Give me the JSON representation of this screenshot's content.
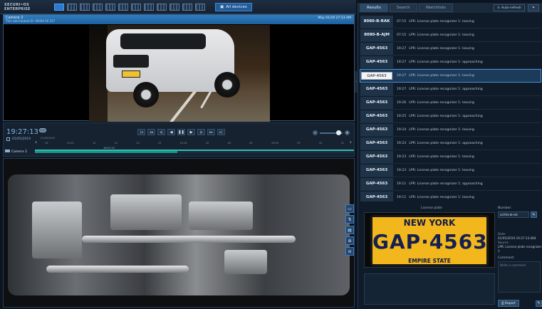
{
  "topbar": {
    "logo_line1": "SECURI•OS",
    "logo_line2": "ENTERPRISE",
    "all_devices": "All devices",
    "layout_icons": [
      "layout-1x1-icon",
      "layout-2x2-icon",
      "layout-3x3-icon",
      "layout-4x4-icon",
      "layout-1p5-icon",
      "layout-1p7-icon",
      "layout-2p8-icon",
      "layout-1p12-icon",
      "layout-5x5-icon",
      "layout-6x6-icon",
      "layout-8x8-icon",
      "layout-custom-icon"
    ]
  },
  "video": {
    "camera_name": "Camera 2",
    "camera_sub": "This sub-module ID: 00000 00 257",
    "timestamp": "May 01/19 27:13 AM"
  },
  "timeline": {
    "time": "19:27:13",
    "date": "01/05/2019",
    "camera_row": "Camera 2",
    "date_mini": "01/05/2019",
    "marker": "19:27:13",
    "ticks": [
      "19",
      "19:05",
      "10",
      "15",
      "20",
      "25",
      "19:30",
      "35",
      "40",
      "45",
      "19:50",
      "55",
      "20",
      "15"
    ]
  },
  "panel": {
    "tabs": [
      "Results",
      "Search",
      "Watchlists"
    ],
    "active_tab": 0,
    "autorefresh": "Auto-refresh",
    "results": [
      {
        "plate": "8080-B-RAK",
        "time": "07:15",
        "event": "LPR: License plate recognizer 1: leaving"
      },
      {
        "plate": "8080-B-AJM",
        "time": "07:15",
        "event": "LPR: License plate recognizer 1: leaving"
      },
      {
        "plate": "GAP-4563",
        "time": "19:27",
        "event": "LPR: License plate recognizer 1: leaving"
      },
      {
        "plate": "GAP-4563",
        "time": "19:27",
        "event": "LPR: License plate recognizer 1: approaching"
      },
      {
        "plate": "GAP-4563",
        "time": "19:27",
        "event": "LPR: License plate recognizer 1: leaving",
        "selected": true
      },
      {
        "plate": "GAP-4563",
        "time": "19:27",
        "event": "LPR: License plate recognizer 1: approaching"
      },
      {
        "plate": "GAP-4563",
        "time": "19:26",
        "event": "LPR: License plate recognizer 1: leaving"
      },
      {
        "plate": "GAP-4563",
        "time": "19:25",
        "event": "LPR: License plate recognizer 1: approaching"
      },
      {
        "plate": "GAP-4563",
        "time": "19:24",
        "event": "LPR: License plate recognizer 1: leaving"
      },
      {
        "plate": "GAP-4563",
        "time": "19:23",
        "event": "LPR: License plate recognizer 1: approaching"
      },
      {
        "plate": "GAP-4563",
        "time": "19:23",
        "event": "LPR: License plate recognizer 1: leaving"
      },
      {
        "plate": "GAP-4563",
        "time": "19:23",
        "event": "LPR: License plate recognizer 1: leaving"
      },
      {
        "plate": "GAP-4563",
        "time": "19:11",
        "event": "LPR: License plate recognizer 1: approaching"
      },
      {
        "plate": "GAP-4563",
        "time": "19:11",
        "event": "LPR: License plate recognizer 1: leaving"
      }
    ],
    "details": {
      "license_plate_label": "License plate",
      "plate_state": "NEW YORK",
      "plate_number": "GAP·4563",
      "plate_footer": "EMPIRE STATE",
      "number_label": "Number:",
      "number_value": "44701-B-AD",
      "date_label": "Date:",
      "date_value": "01/05/2019 19:27:13.084",
      "source_label": "Source:",
      "source_value": "LPR: License plate recognizer 1",
      "comment_label": "Comment:",
      "comment_placeholder": "Write a comment",
      "report_label": "Report"
    }
  },
  "colors": {
    "accent": "#2f77c9",
    "plate_yellow": "#f2b71d",
    "teal": "#1e8f86"
  }
}
